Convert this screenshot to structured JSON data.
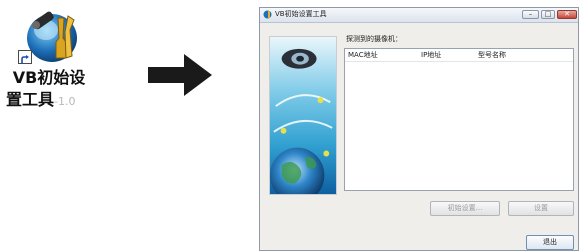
{
  "desktop": {
    "shortcut_line1": "VB初始设",
    "shortcut_line2": "置工具",
    "shortcut_version": "-1.0",
    "icon": "camera-tools-icon"
  },
  "window": {
    "title": "VB初始设置工具",
    "found_label": "探测到的摄像机：",
    "columns": [
      "MAC地址",
      "IP地址",
      "型号名称"
    ],
    "buttons": {
      "init": "初始设置...",
      "settings": "设置",
      "exit": "退出"
    },
    "caption_glyphs": {
      "minimize": "–",
      "maximize": "□",
      "close": "✕"
    }
  },
  "colors": {
    "arrow": "#1a1a1a",
    "banner_sky": "#2f9fd0",
    "banner_glow": "#e8e04a"
  }
}
